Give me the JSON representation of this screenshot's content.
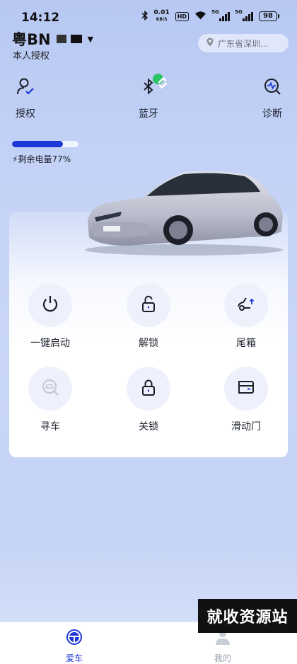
{
  "status_bar": {
    "time": "14:12",
    "net_speed_value": "0.01",
    "net_speed_unit": "KB/S",
    "hd": "HD",
    "signal_1": "5G",
    "signal_2": "5G",
    "battery": "98"
  },
  "header": {
    "plate": "粤BN",
    "auth_sub": "本人授权",
    "location": "广东省深圳..."
  },
  "tools": [
    {
      "label": "授权",
      "icon": "user-check-icon"
    },
    {
      "label": "蓝牙",
      "icon": "bluetooth-icon"
    },
    {
      "label": "诊断",
      "icon": "diagnose-icon"
    }
  ],
  "battery": {
    "level": 0.77,
    "text": "剩余电量77%"
  },
  "controls": [
    {
      "label": "一键启动",
      "icon": "power-icon"
    },
    {
      "label": "解锁",
      "icon": "unlock-icon"
    },
    {
      "label": "尾箱",
      "icon": "trunk-icon"
    },
    {
      "label": "寻车",
      "icon": "find-car-icon"
    },
    {
      "label": "关锁",
      "icon": "lock-icon"
    },
    {
      "label": "滑动门",
      "icon": "sliding-door-icon"
    }
  ],
  "bottom_nav": [
    {
      "label": "爱车",
      "active": true
    },
    {
      "label": "我的",
      "active": false
    }
  ],
  "watermark": "就收资源站",
  "colors": {
    "accent": "#1f37d6",
    "bt_badge": "#2bc467"
  }
}
